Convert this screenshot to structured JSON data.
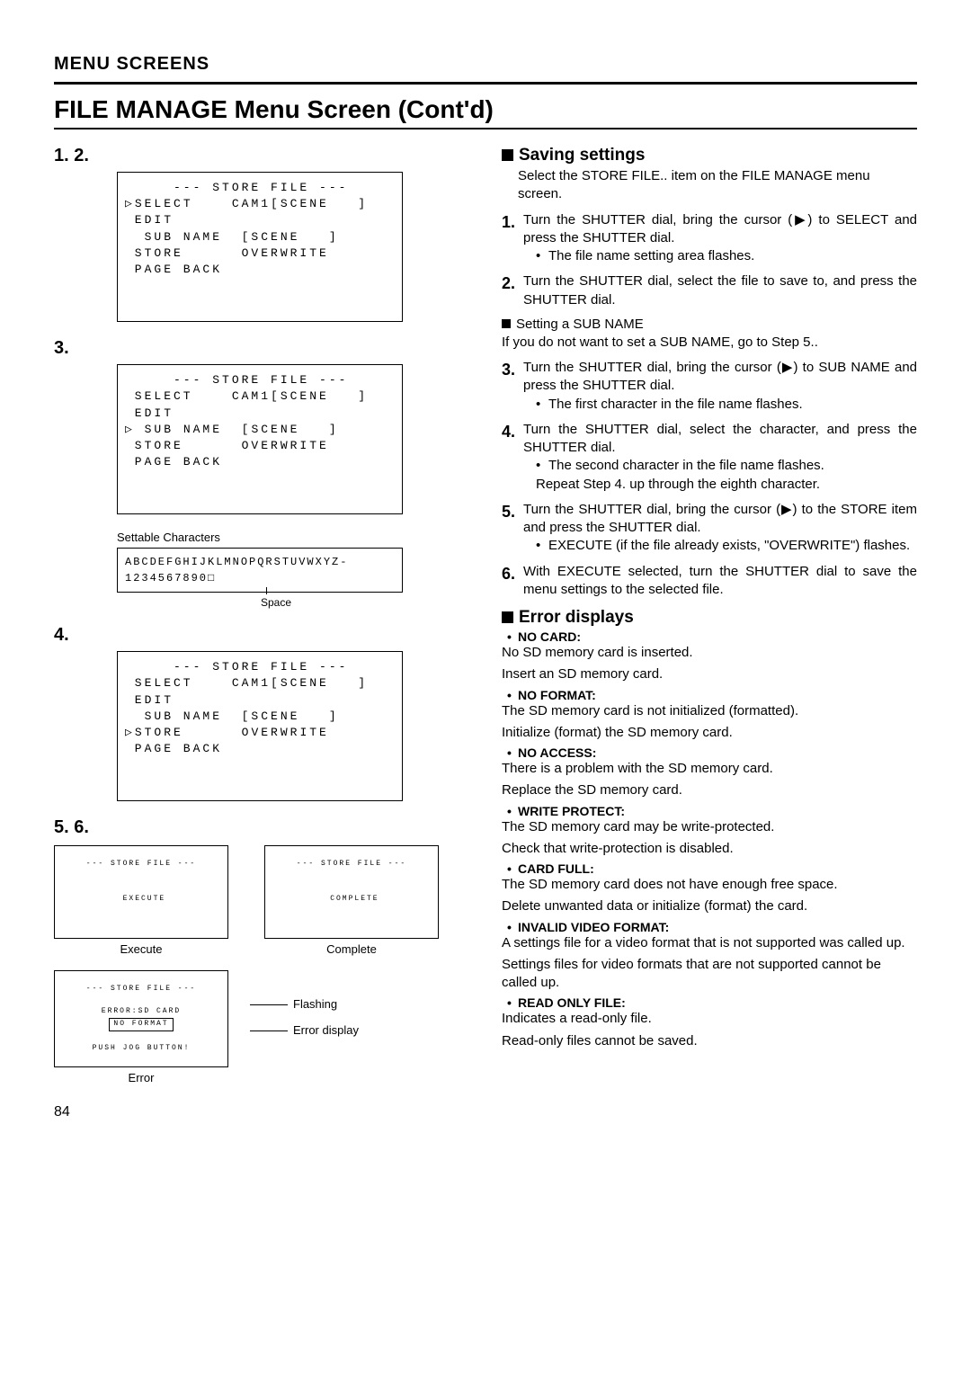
{
  "header": "MENU SCREENS",
  "title": "FILE MANAGE Menu Screen (Cont'd)",
  "page_number": "84",
  "left": {
    "step12_label": "1. 2.",
    "menu_box_a": "     --- STORE FILE ---\n▷SELECT    CAM1[SCENE   ]\n EDIT\n  SUB NAME  [SCENE   ]\n STORE      OVERWRITE\n PAGE BACK",
    "step3_label": "3.",
    "menu_box_b": "     --- STORE FILE ---\n SELECT    CAM1[SCENE   ]\n EDIT\n▷ SUB NAME  [SCENE   ]\n STORE      OVERWRITE\n PAGE BACK",
    "settable_label": "Settable Characters",
    "char_box": "ABCDEFGHIJKLMNOPQRSTUVWXYZ-\n1234567890□",
    "space_label": "Space",
    "step4_label": "4.",
    "menu_box_c": "     --- STORE FILE ---\n SELECT    CAM1[SCENE   ]\n EDIT\n  SUB NAME  [SCENE   ]\n▷STORE      OVERWRITE\n PAGE BACK",
    "step56_label": "5. 6.",
    "exec_box": "--- STORE FILE ---\n\n\n EXECUTE",
    "exec_caption": "Execute",
    "complete_box": "--- STORE FILE ---\n\n\n COMPLETE",
    "complete_caption": "Complete",
    "error_box_title": "--- STORE FILE ---",
    "error_box_line": "ERROR:SD CARD",
    "error_box_boxed": "NO FORMAT",
    "error_box_push": "PUSH JOG BUTTON!",
    "error_caption": "Error",
    "flashing_annot": "Flashing",
    "error_display_annot": "Error display"
  },
  "right": {
    "saving_heading": "Saving settings",
    "saving_intro": "Select the STORE FILE.. item on the FILE MANAGE menu screen.",
    "steps": [
      {
        "n": "1.",
        "text": "Turn the SHUTTER dial, bring the cursor (▶) to SELECT and press the SHUTTER dial.",
        "bullets": [
          "The file name setting area flashes."
        ]
      },
      {
        "n": "2.",
        "text": "Turn the SHUTTER dial, select the file to save to, and press the SHUTTER dial.",
        "sq_line": "Setting a SUB NAME",
        "plain": "If you do not want to set a SUB NAME, go to Step 5.."
      },
      {
        "n": "3.",
        "text": "Turn the SHUTTER dial, bring the cursor (▶) to SUB NAME and press the SHUTTER dial.",
        "bullets": [
          "The first character in the file name flashes."
        ]
      },
      {
        "n": "4.",
        "text": "Turn the SHUTTER dial, select the character, and press the SHUTTER dial.",
        "bullets": [
          "The second character in the file name flashes."
        ],
        "plain2": "Repeat Step 4. up through the eighth character."
      },
      {
        "n": "5.",
        "text": "Turn the SHUTTER dial, bring the cursor (▶) to the STORE item and press the SHUTTER dial.",
        "bullets": [
          "EXECUTE (if the file already exists, \"OVERWRITE\") flashes."
        ]
      },
      {
        "n": "6.",
        "text": "With EXECUTE selected, turn the SHUTTER dial to save the menu settings to the selected file."
      }
    ],
    "error_heading": "Error displays",
    "errors": [
      {
        "label": "NO CARD:",
        "lines": [
          "No SD memory card is inserted.",
          "Insert an SD memory card."
        ]
      },
      {
        "label": "NO FORMAT:",
        "lines": [
          "The SD memory card is not initialized (formatted).",
          "Initialize (format) the SD memory card."
        ]
      },
      {
        "label": "NO ACCESS:",
        "lines": [
          "There is a problem with the SD memory card.",
          "Replace the SD memory card."
        ]
      },
      {
        "label": "WRITE PROTECT:",
        "lines": [
          "The SD memory card may be write-protected.",
          "Check that write-protection is disabled."
        ]
      },
      {
        "label": "CARD FULL:",
        "lines": [
          "The SD memory card does not have enough free space.",
          "Delete unwanted data or initialize (format) the card."
        ]
      },
      {
        "label": "INVALID VIDEO FORMAT:",
        "lines": [
          "A settings file for a video format that is not supported was called up.",
          "Settings files for video formats that are not supported cannot be called up."
        ]
      },
      {
        "label": "READ ONLY FILE:",
        "lines": [
          "Indicates a read-only file.",
          "Read-only files cannot be saved."
        ]
      }
    ]
  }
}
